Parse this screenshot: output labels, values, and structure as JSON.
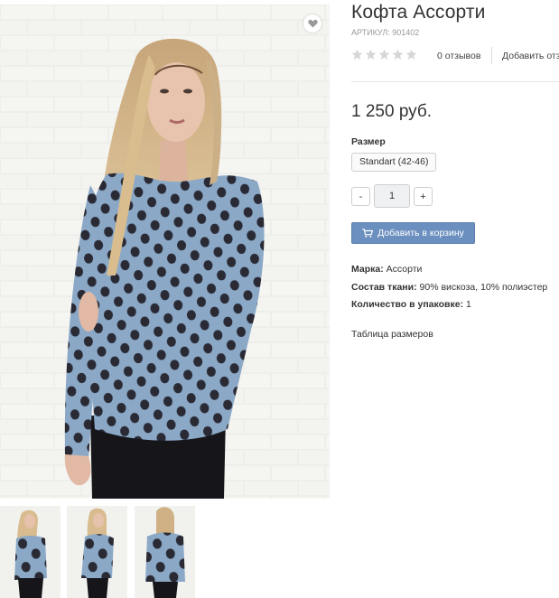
{
  "product": {
    "title": "Кофта Ассорти",
    "sku_label": "АРТИКУЛ:",
    "sku_value": "901402",
    "rating": 0,
    "rating_max": 5,
    "reviews_label": "0 отзывов",
    "add_review_label": "Добавить отз",
    "price": "1 250 руб."
  },
  "size": {
    "label": "Размер",
    "options": [
      "Standart (42-46)"
    ]
  },
  "quantity": {
    "minus_label": "-",
    "value": "1",
    "plus_label": "+"
  },
  "cart": {
    "button_label": "Добавить в корзину",
    "icon": "cart-icon"
  },
  "properties": [
    {
      "label": "Марка:",
      "value": "Ассорти"
    },
    {
      "label": "Состав ткани:",
      "value": "90% вискоза, 10% полиэстер"
    },
    {
      "label": "Количество в упаковке:",
      "value": "1"
    }
  ],
  "links": {
    "size_table": "Таблица размеров"
  },
  "icons": {
    "wishlist": "heart-icon",
    "star": "star-icon"
  },
  "colors": {
    "button_blue": "#6b8fbf",
    "star_inactive": "#d6d6d6",
    "garment_blue": "#8ba9c7",
    "polka_dot": "#2a2a35"
  },
  "thumbnails_count": 3
}
